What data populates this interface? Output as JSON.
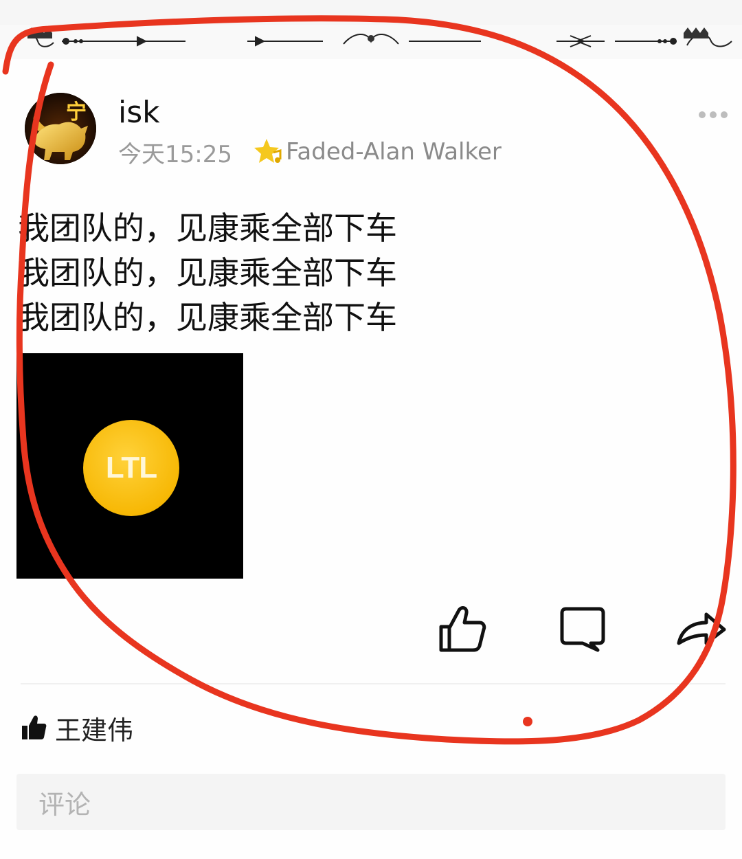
{
  "post": {
    "author": "isk",
    "time": "今天15:25",
    "music": "Faded-Alan Walker",
    "lines": [
      "我团队的，见康乘全部下车",
      "我团队的，见康乘全部下车",
      "我团队的，见康乘全部下车"
    ],
    "image_logo_text": "LTL",
    "avatar_char": "宁"
  },
  "likes": {
    "names": "王建伟"
  },
  "comment": {
    "placeholder": "评论"
  },
  "icons": {
    "more": "more-dots-icon",
    "music": "star-music-icon",
    "like": "thumbs-up-icon",
    "comment": "comment-bubble-icon",
    "share": "share-arrow-icon",
    "liked": "thumbs-up-filled-icon"
  },
  "colors": {
    "annotation": "#e8351f",
    "coin": "#f7b805",
    "meta_text": "#9a9a9a"
  }
}
